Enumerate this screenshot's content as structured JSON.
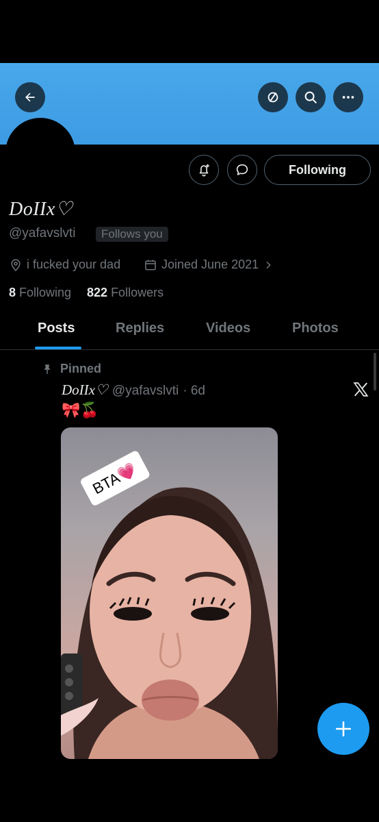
{
  "header": {
    "back_icon": "arrow-left-icon",
    "hide_icon": "eye-slash-icon",
    "search_icon": "search-icon",
    "more_icon": "more-horizontal-icon",
    "banner_color": "#48a8ea"
  },
  "profile": {
    "display_name": "DoIIx♡",
    "handle": "@yafavslvti",
    "follows_you": "Follows you",
    "location": "i fucked your dad",
    "joined": "Joined June 2021",
    "following_count": "8",
    "following_label": "Following",
    "followers_count": "822",
    "followers_label": "Followers"
  },
  "actions": {
    "notify_icon": "bell-plus-icon",
    "message_icon": "chat-bubble-icon",
    "following_button": "Following"
  },
  "tabs": [
    {
      "label": "Posts",
      "active": true
    },
    {
      "label": "Replies",
      "active": false
    },
    {
      "label": "Videos",
      "active": false
    },
    {
      "label": "Photos",
      "active": false
    }
  ],
  "post": {
    "pinned_label": "Pinned",
    "author_name": "DoIIx♡",
    "author_handle": "@yafavslvti",
    "time": "· 6d",
    "emojis": "🎀🍒",
    "sticker_text": "BTA💗"
  },
  "fab": {
    "icon": "plus-icon"
  },
  "colors": {
    "accent": "#1d9bf0",
    "muted": "#71767b"
  }
}
